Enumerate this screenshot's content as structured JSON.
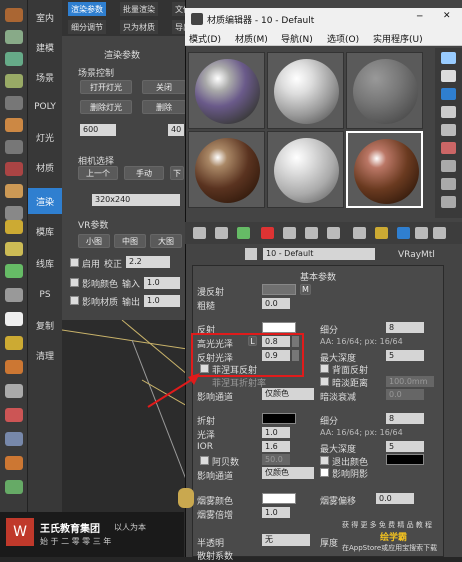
{
  "left_categories": [
    "室内",
    "建模",
    "场景",
    "POLY",
    "灯光",
    "材质",
    "渲染",
    "模库",
    "线库",
    "PS",
    "复制",
    "清理"
  ],
  "active_category": "渲染",
  "render_tabs": [
    "渲染参数",
    "批量渲染",
    "文件归类",
    "细分调节",
    "只为材质",
    "导出"
  ],
  "render_panel": {
    "section_title": "渲染参数",
    "scene_control_label": "场景控制",
    "buttons": [
      "打开灯光",
      "关闭",
      "删除灯光",
      "删除"
    ],
    "spin_values": [
      "600",
      "40"
    ],
    "camera_label": "相机选择",
    "camera_buttons": [
      "上一个",
      "手动",
      "下"
    ],
    "resolution": "320x240",
    "vr_section": "VR参数",
    "size_buttons": [
      "小图",
      "中图",
      "大图"
    ],
    "enable_label": "启用",
    "correct_label": "校正",
    "correct_value": "2.2",
    "affect_color_label": "影响颜色",
    "input_label": "输入",
    "input_value": "1.0",
    "affect_material_label": "影响材质",
    "output_label": "输出",
    "output_value": "1.0"
  },
  "material_editor": {
    "window_title": "材质编辑器 - 10 - Default",
    "menus": [
      "模式(D)",
      "材质(M)",
      "导航(N)",
      "选项(O)",
      "实用程序(U)"
    ],
    "material_name": "10 - Default",
    "material_type": "VRayMtl"
  },
  "basic_params": {
    "title": "基本参数",
    "diffuse_label": "漫反射",
    "roughness_label": "粗糙",
    "roughness_value": "0.0",
    "m_label": "M",
    "reflect_label": "反射",
    "subdiv_label": "细分",
    "subdiv_value": "8",
    "gloss_label": "高光光泽",
    "gloss_lock": "L",
    "gloss_value": "0.8",
    "aa_label": "AA: 16/64; px: 16/64",
    "refl_gloss_label": "反射光泽",
    "refl_gloss_value": "0.9",
    "max_depth_label": "最大深度",
    "max_depth_value": "5",
    "fresnel_label": "菲涅耳反射",
    "back_reflect_label": "背面反射",
    "fresnel_ior_label": "菲涅耳折射率",
    "dim_distance_label": "暗淡距离",
    "dim_distance_value": "100.0mm",
    "affect_channel_label": "影响通道",
    "affect_channel_value": "仅颜色",
    "dim_falloff_label": "暗淡衰减",
    "dim_falloff_value": "0.0",
    "refract_label": "折射",
    "refract_subdiv_label": "细分",
    "refract_subdiv_value": "8",
    "glossiness_label": "光泽",
    "glossiness_value": "1.0",
    "refract_aa_label": "AA: 16/64; px: 16/64",
    "ior_label": "IOR",
    "ior_value": "1.6",
    "refract_depth_label": "最大深度",
    "refract_depth_value": "5",
    "abbe_label": "阿贝数",
    "abbe_value": "50.0",
    "exit_color_label": "退出颜色",
    "affect_channel2_label": "影响通道",
    "affect_channel2_value": "仅颜色",
    "affect_shadow_label": "影响阴影",
    "fog_color_label": "烟雾颜色",
    "fog_bias_label": "烟雾偏移",
    "fog_bias_value": "0.0",
    "fog_mult_label": "烟雾倍增",
    "fog_mult_value": "1.0",
    "translucent_label": "半透明",
    "translucent_value": "无",
    "thickness_label": "厚度",
    "scatter_label": "散射系数",
    "colors": {
      "diffuse": "#707070",
      "reflect": "#ffffff",
      "refract": "#000000",
      "fog": "#ffffff",
      "accent": "#2f7fd0",
      "annotation": "#e01b1b"
    }
  },
  "watermark": {
    "company": "王氏教育集团",
    "tagline": "以人为本",
    "slogan": "始 于 二 零 零 三 年",
    "promo1": "获 得 更 多 免 费 精 品 教 程",
    "promo2": "在AppStore或应用宝搜索下载",
    "app": "绘学霸"
  }
}
